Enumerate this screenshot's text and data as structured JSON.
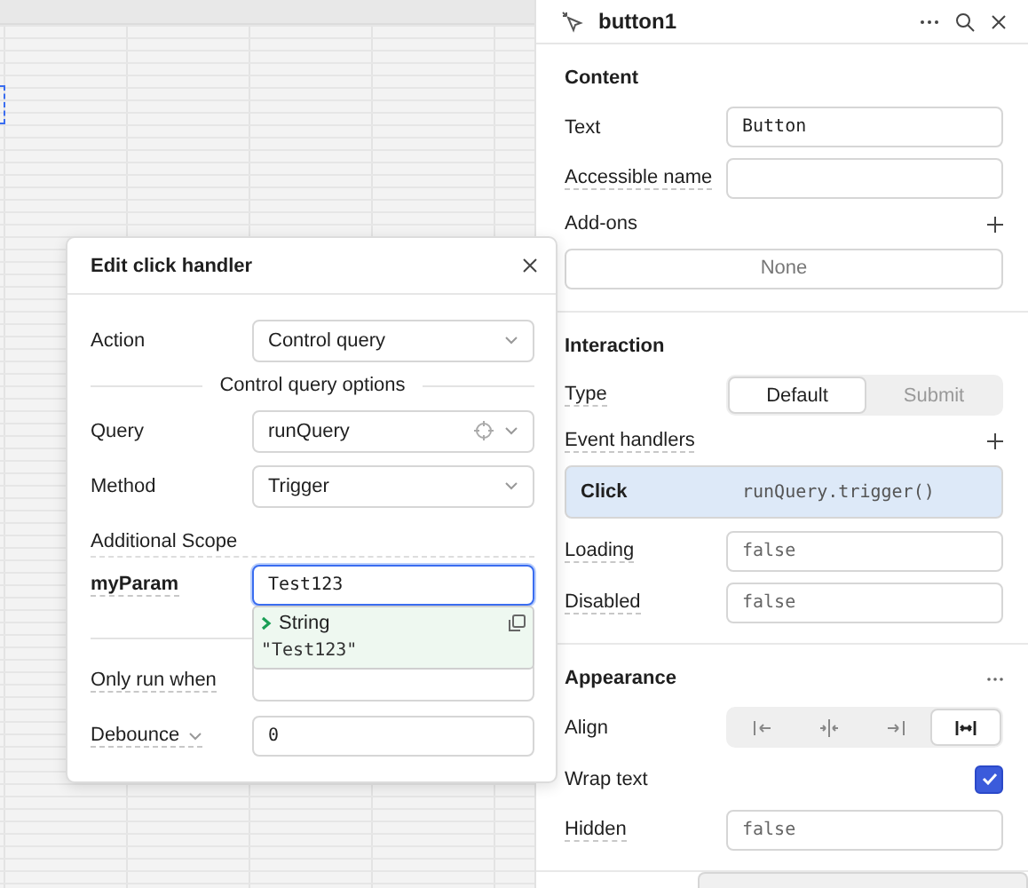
{
  "inspector": {
    "title": "button1",
    "sections": [
      {
        "title": "Content",
        "menu": false,
        "rows": [
          {
            "kind": "field",
            "label": "Text",
            "value": "Button",
            "underlined": false
          },
          {
            "kind": "field",
            "label": "Accessible name",
            "underlined": true
          },
          {
            "kind": "list",
            "label": "Add-ons",
            "empty_text": "None",
            "underlined": false
          }
        ]
      },
      {
        "title": "Interaction",
        "menu": false,
        "rows": [
          {
            "kind": "segmented",
            "label": "Type",
            "underlined": true,
            "options": [
              {
                "label": "Default",
                "selected": true
              },
              {
                "label": "Submit",
                "selected": false
              }
            ]
          },
          {
            "kind": "handlers",
            "label": "Event handlers",
            "underlined": true,
            "handlers": [
              {
                "event": "Click",
                "action": "runQuery.trigger()",
                "selected": true
              }
            ]
          },
          {
            "kind": "field",
            "label": "Loading",
            "value": "false",
            "underlined": true
          },
          {
            "kind": "field",
            "label": "Disabled",
            "value": "false",
            "underlined": true
          }
        ]
      },
      {
        "title": "Appearance",
        "menu": true,
        "rows": [
          {
            "kind": "align",
            "label": "Align",
            "underlined": false,
            "options": [
              {
                "selected": false
              },
              {
                "selected": false
              },
              {
                "selected": false
              },
              {
                "selected": true
              }
            ]
          },
          {
            "kind": "checkbox",
            "label": "Wrap text",
            "checked": true,
            "underlined": false
          },
          {
            "kind": "field",
            "label": "Hidden",
            "value": "false",
            "underlined": true
          }
        ]
      }
    ]
  },
  "dialog": {
    "title": "Edit click handler",
    "rows": [
      {
        "kind": "select",
        "label": "Action",
        "value": "Control query"
      },
      {
        "kind": "divider",
        "label": "Control query options"
      },
      {
        "kind": "select",
        "label": "Query",
        "value": "runQuery",
        "picker": true
      },
      {
        "kind": "select",
        "label": "Method",
        "value": "Trigger"
      },
      {
        "kind": "heading",
        "label": "Additional Scope"
      },
      {
        "kind": "scope",
        "label": "myParam",
        "value": "Test123",
        "focused": true,
        "popup": {
          "type": "String",
          "value": "\"Test123\""
        }
      },
      {
        "kind": "rule"
      },
      {
        "kind": "field",
        "label": "Only run when"
      },
      {
        "kind": "field",
        "label": "Debounce",
        "value": "0",
        "caret": true
      }
    ]
  }
}
